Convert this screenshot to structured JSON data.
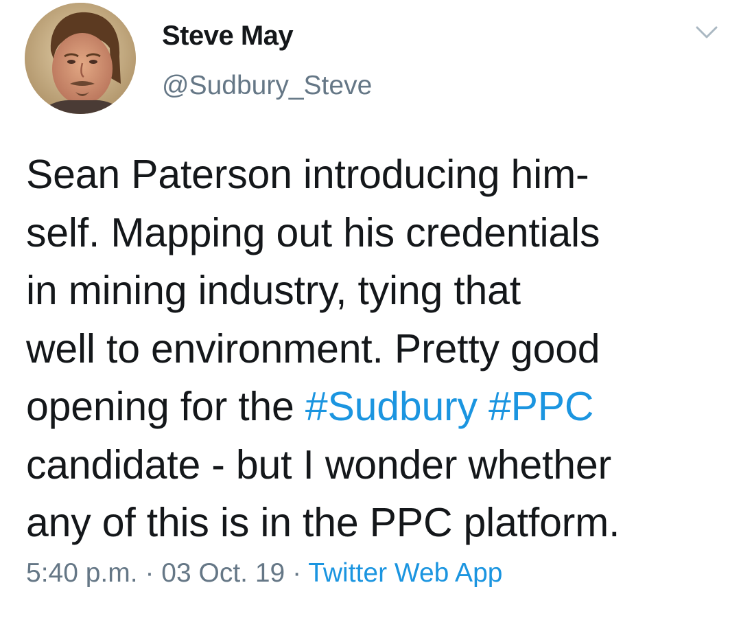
{
  "tweet": {
    "author": {
      "display_name": "Steve May",
      "handle": "@Sudbury_Steve"
    },
    "menu_icon": "chevron-down-icon",
    "text_lines": [
      [
        "Sean Paterson introducing him-"
      ],
      [
        "self. Mapping out his credentials"
      ],
      [
        "in mining industry, tying that"
      ],
      [
        "well to environment. Pretty good"
      ],
      [
        "opening for the ",
        "#Sudbury",
        " ",
        "#PPC"
      ],
      [
        "candidate - but I wonder whether"
      ],
      [
        "any of this is in the PPC platform."
      ]
    ],
    "hashtags": [
      "#Sudbury",
      "#PPC"
    ],
    "time": "5:40 p.m.",
    "separator": "·",
    "date": "03 Oct. 19",
    "source": "Twitter Web App",
    "colors": {
      "text": "#14171a",
      "secondary": "#657786",
      "link": "#1b95e0"
    }
  }
}
